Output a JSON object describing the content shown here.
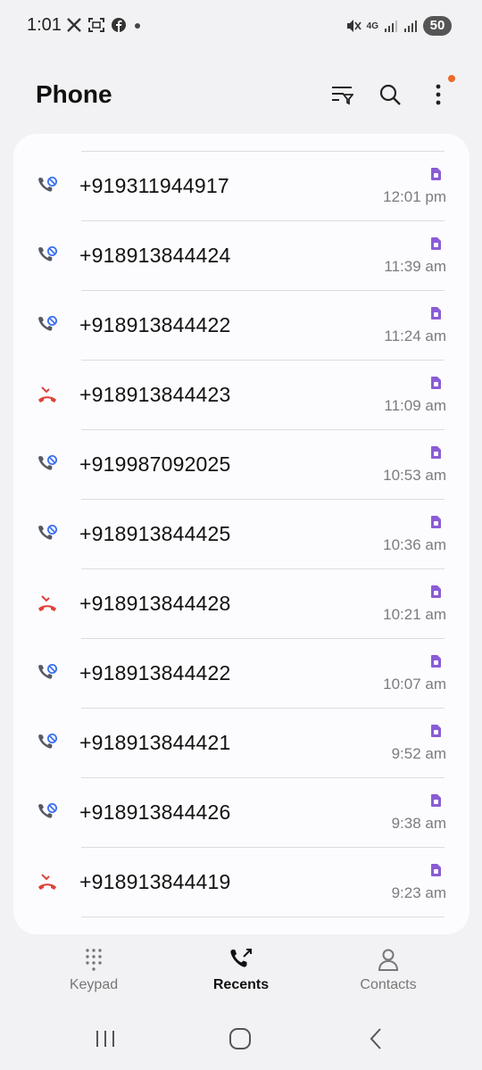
{
  "status_bar": {
    "time": "1:01",
    "left_icons": [
      "x-icon",
      "screenshot-icon",
      "facebook-icon",
      "dot-icon"
    ],
    "network": "4G",
    "battery": "50"
  },
  "app_bar": {
    "title": "Phone",
    "actions": [
      "filter-icon",
      "search-icon",
      "more-icon"
    ],
    "notification_color": "#ee6a2a"
  },
  "calls": [
    {
      "number": "+919311944917",
      "time": "12:01 pm",
      "type": "blocked"
    },
    {
      "number": "+918913844424",
      "time": "11:39 am",
      "type": "blocked"
    },
    {
      "number": "+918913844422",
      "time": "11:24 am",
      "type": "blocked"
    },
    {
      "number": "+918913844423",
      "time": "11:09 am",
      "type": "missed"
    },
    {
      "number": "+919987092025",
      "time": "10:53 am",
      "type": "blocked"
    },
    {
      "number": "+918913844425",
      "time": "10:36 am",
      "type": "blocked"
    },
    {
      "number": "+918913844428",
      "time": "10:21 am",
      "type": "missed"
    },
    {
      "number": "+918913844422",
      "time": "10:07 am",
      "type": "blocked"
    },
    {
      "number": "+918913844421",
      "time": "9:52 am",
      "type": "blocked"
    },
    {
      "number": "+918913844426",
      "time": "9:38 am",
      "type": "blocked"
    },
    {
      "number": "+918913844419",
      "time": "9:23 am",
      "type": "missed"
    }
  ],
  "colors": {
    "sim_purple": "#8a5cd6",
    "blocked_blue": "#3c6ff0",
    "missed_red": "#e0413a",
    "phone_gray": "#555a64"
  },
  "bottom_nav": {
    "tabs": [
      {
        "label": "Keypad",
        "icon": "keypad-icon",
        "active": false
      },
      {
        "label": "Recents",
        "icon": "recents-icon",
        "active": true
      },
      {
        "label": "Contacts",
        "icon": "contacts-icon",
        "active": false
      }
    ]
  },
  "system_nav": [
    "recent-apps-icon",
    "home-icon",
    "back-icon"
  ]
}
